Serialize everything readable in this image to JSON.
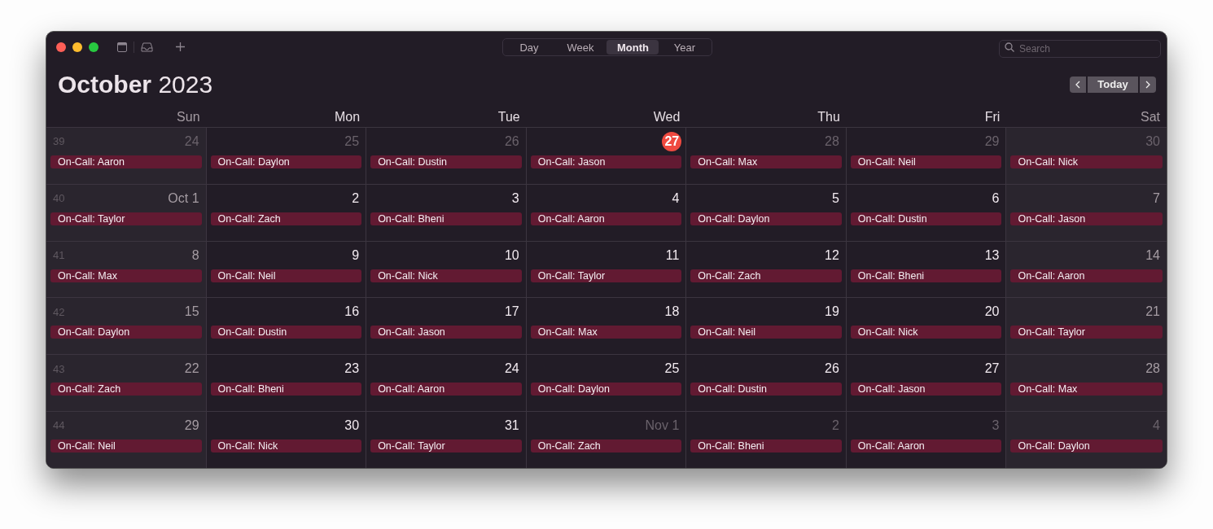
{
  "toolbar": {
    "views": [
      {
        "label": "Day",
        "selected": false
      },
      {
        "label": "Week",
        "selected": false
      },
      {
        "label": "Month",
        "selected": true
      },
      {
        "label": "Year",
        "selected": false
      }
    ],
    "search": {
      "placeholder": "Search"
    }
  },
  "header": {
    "month": "October",
    "year": "2023",
    "today_button": "Today"
  },
  "weekdays": [
    "Sun",
    "Mon",
    "Tue",
    "Wed",
    "Thu",
    "Fri",
    "Sat"
  ],
  "weeks": [
    {
      "week_number": "39",
      "days": [
        {
          "label": "24",
          "in_month": false,
          "today": false,
          "event": "On-Call: Aaron"
        },
        {
          "label": "25",
          "in_month": false,
          "today": false,
          "event": "On-Call: Daylon"
        },
        {
          "label": "26",
          "in_month": false,
          "today": false,
          "event": "On-Call: Dustin"
        },
        {
          "label": "27",
          "in_month": false,
          "today": true,
          "event": "On-Call: Jason"
        },
        {
          "label": "28",
          "in_month": false,
          "today": false,
          "event": "On-Call: Max"
        },
        {
          "label": "29",
          "in_month": false,
          "today": false,
          "event": "On-Call: Neil"
        },
        {
          "label": "30",
          "in_month": false,
          "today": false,
          "event": "On-Call: Nick"
        }
      ]
    },
    {
      "week_number": "40",
      "days": [
        {
          "label": "Oct 1",
          "in_month": true,
          "today": false,
          "event": "On-Call: Taylor"
        },
        {
          "label": "2",
          "in_month": true,
          "today": false,
          "event": "On-Call: Zach"
        },
        {
          "label": "3",
          "in_month": true,
          "today": false,
          "event": "On-Call: Bheni"
        },
        {
          "label": "4",
          "in_month": true,
          "today": false,
          "event": "On-Call: Aaron"
        },
        {
          "label": "5",
          "in_month": true,
          "today": false,
          "event": "On-Call: Daylon"
        },
        {
          "label": "6",
          "in_month": true,
          "today": false,
          "event": "On-Call: Dustin"
        },
        {
          "label": "7",
          "in_month": true,
          "today": false,
          "event": "On-Call: Jason"
        }
      ]
    },
    {
      "week_number": "41",
      "days": [
        {
          "label": "8",
          "in_month": true,
          "today": false,
          "event": "On-Call: Max"
        },
        {
          "label": "9",
          "in_month": true,
          "today": false,
          "event": "On-Call: Neil"
        },
        {
          "label": "10",
          "in_month": true,
          "today": false,
          "event": "On-Call: Nick"
        },
        {
          "label": "11",
          "in_month": true,
          "today": false,
          "event": "On-Call: Taylor"
        },
        {
          "label": "12",
          "in_month": true,
          "today": false,
          "event": "On-Call: Zach"
        },
        {
          "label": "13",
          "in_month": true,
          "today": false,
          "event": "On-Call: Bheni"
        },
        {
          "label": "14",
          "in_month": true,
          "today": false,
          "event": "On-Call: Aaron"
        }
      ]
    },
    {
      "week_number": "42",
      "days": [
        {
          "label": "15",
          "in_month": true,
          "today": false,
          "event": "On-Call: Daylon"
        },
        {
          "label": "16",
          "in_month": true,
          "today": false,
          "event": "On-Call: Dustin"
        },
        {
          "label": "17",
          "in_month": true,
          "today": false,
          "event": "On-Call: Jason"
        },
        {
          "label": "18",
          "in_month": true,
          "today": false,
          "event": "On-Call: Max"
        },
        {
          "label": "19",
          "in_month": true,
          "today": false,
          "event": "On-Call: Neil"
        },
        {
          "label": "20",
          "in_month": true,
          "today": false,
          "event": "On-Call: Nick"
        },
        {
          "label": "21",
          "in_month": true,
          "today": false,
          "event": "On-Call: Taylor"
        }
      ]
    },
    {
      "week_number": "43",
      "days": [
        {
          "label": "22",
          "in_month": true,
          "today": false,
          "event": "On-Call: Zach"
        },
        {
          "label": "23",
          "in_month": true,
          "today": false,
          "event": "On-Call: Bheni"
        },
        {
          "label": "24",
          "in_month": true,
          "today": false,
          "event": "On-Call: Aaron"
        },
        {
          "label": "25",
          "in_month": true,
          "today": false,
          "event": "On-Call: Daylon"
        },
        {
          "label": "26",
          "in_month": true,
          "today": false,
          "event": "On-Call: Dustin"
        },
        {
          "label": "27",
          "in_month": true,
          "today": false,
          "event": "On-Call: Jason"
        },
        {
          "label": "28",
          "in_month": true,
          "today": false,
          "event": "On-Call: Max"
        }
      ]
    },
    {
      "week_number": "44",
      "days": [
        {
          "label": "29",
          "in_month": true,
          "today": false,
          "event": "On-Call: Neil"
        },
        {
          "label": "30",
          "in_month": true,
          "today": false,
          "event": "On-Call: Nick"
        },
        {
          "label": "31",
          "in_month": true,
          "today": false,
          "event": "On-Call: Taylor"
        },
        {
          "label": "Nov 1",
          "in_month": false,
          "today": false,
          "event": "On-Call: Zach"
        },
        {
          "label": "2",
          "in_month": false,
          "today": false,
          "event": "On-Call: Bheni"
        },
        {
          "label": "3",
          "in_month": false,
          "today": false,
          "event": "On-Call: Aaron"
        },
        {
          "label": "4",
          "in_month": false,
          "today": false,
          "event": "On-Call: Daylon"
        }
      ]
    }
  ]
}
